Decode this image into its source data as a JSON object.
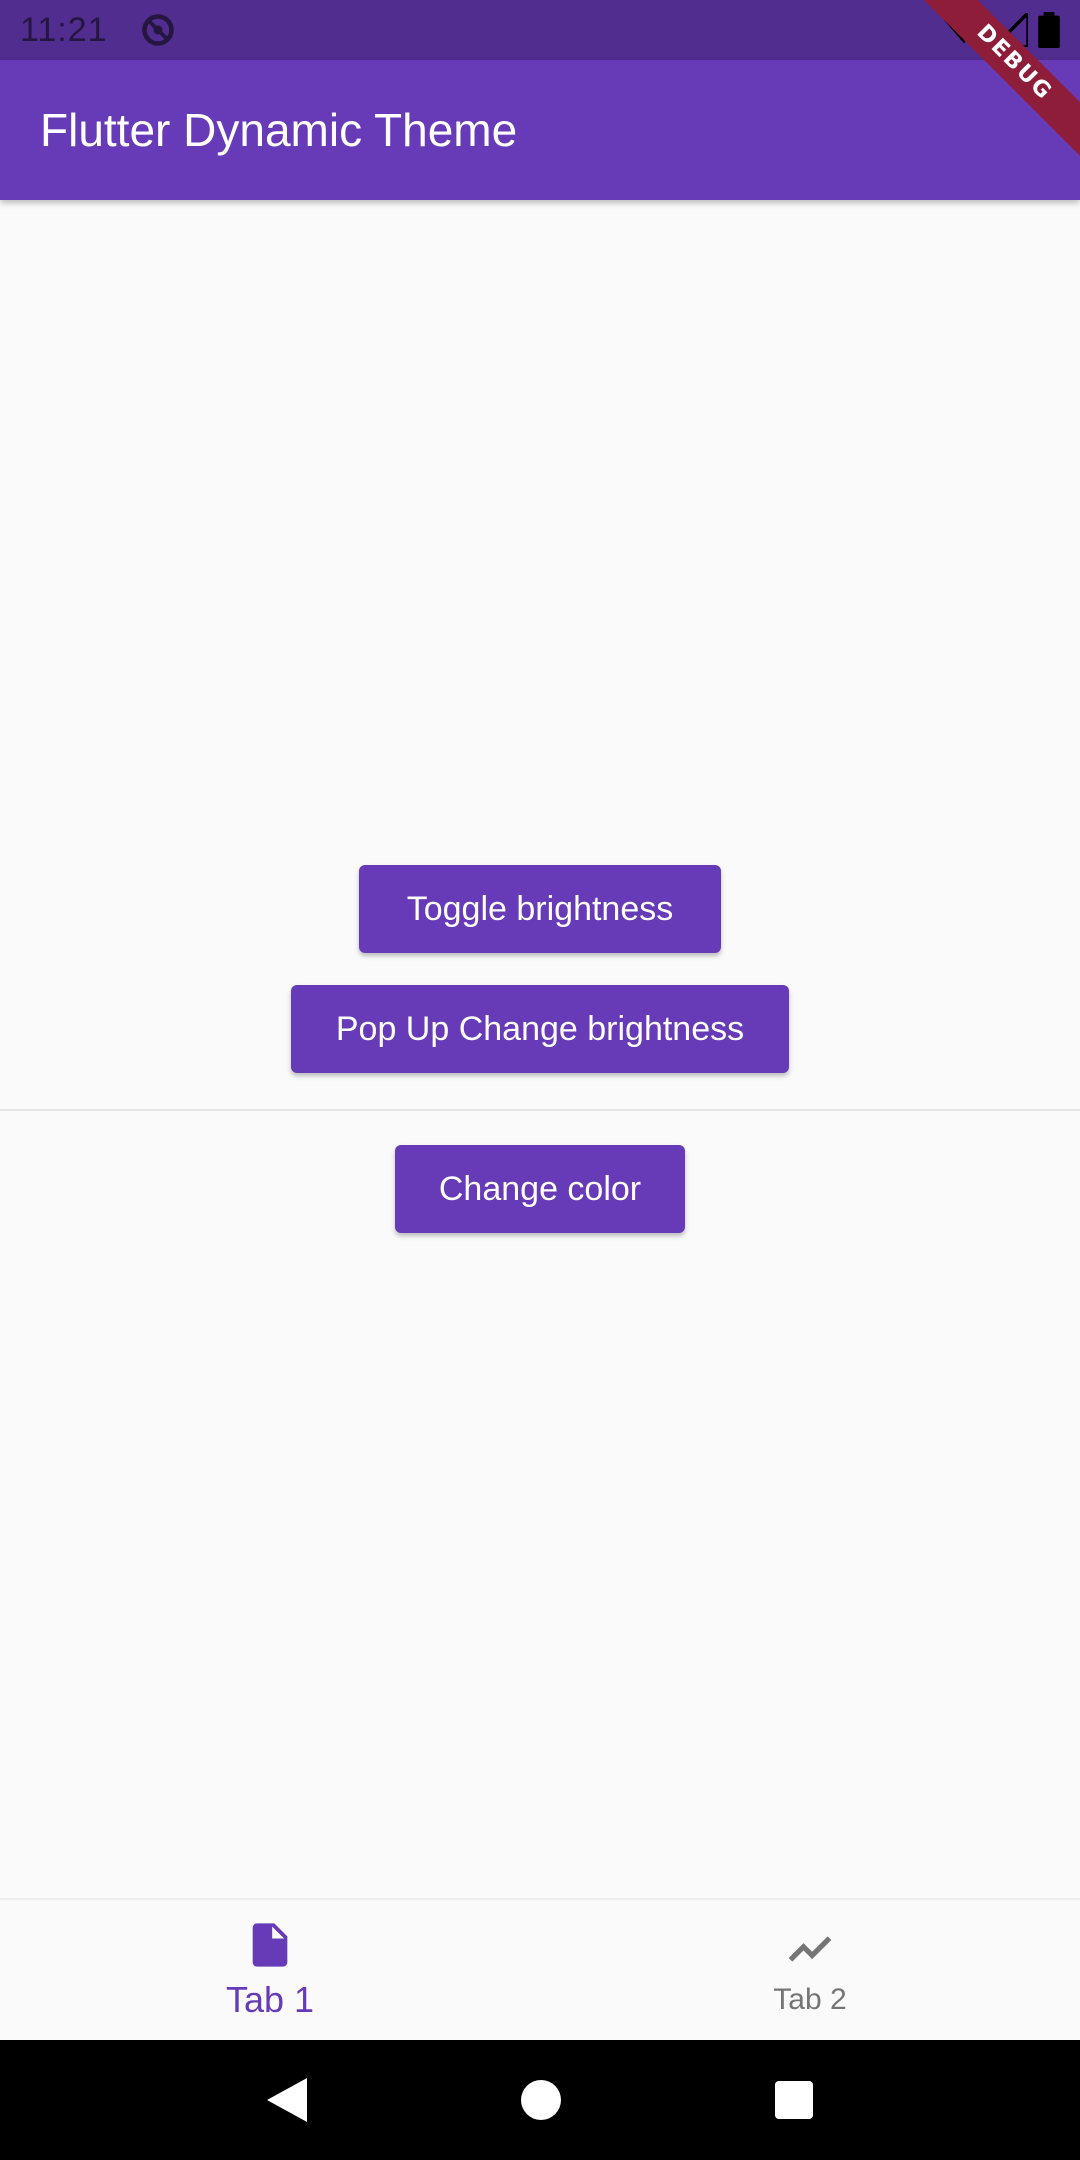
{
  "status_bar": {
    "time": "11:21",
    "icons": [
      "sync-icon",
      "wifi-icon",
      "signal-icon",
      "battery-icon"
    ]
  },
  "debug_banner": {
    "label": "DEBUG"
  },
  "app_bar": {
    "title": "Flutter Dynamic Theme"
  },
  "buttons": {
    "toggle_brightness": "Toggle brightness",
    "popup_change_brightness": "Pop Up Change brightness",
    "change_color": "Change color"
  },
  "bottom_nav": {
    "tabs": [
      {
        "label": "Tab 1",
        "icon": "insert-drive-file-icon",
        "active": true
      },
      {
        "label": "Tab 2",
        "icon": "show-chart-icon",
        "active": false
      }
    ]
  },
  "system_nav": {
    "icons": [
      "back-icon",
      "home-icon",
      "recents-icon"
    ]
  },
  "colors": {
    "primary": "#673ab7",
    "status_bar": "#512d8f",
    "background": "#fafafa",
    "debug_ribbon": "#8e1d3a",
    "inactive": "#757575"
  }
}
